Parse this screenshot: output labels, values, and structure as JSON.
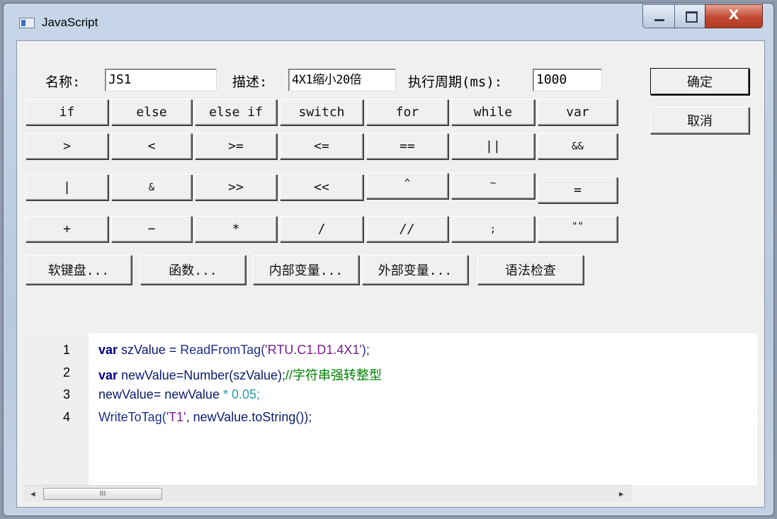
{
  "window": {
    "title": "JavaScript",
    "close_symbol": "X"
  },
  "form": {
    "name_label": "名称:",
    "name_value": "JS1",
    "desc_label": "描述:",
    "desc_value": "4X1缩小20倍",
    "period_label": "执行周期(ms):",
    "period_value": "1000"
  },
  "actions": {
    "ok": "确定",
    "cancel": "取消"
  },
  "keypad": {
    "row1": [
      "if",
      "else",
      "else if",
      "switch",
      "for",
      "while",
      "var"
    ],
    "row2": [
      ">",
      "<",
      ">=",
      "<=",
      "==",
      "||",
      "&&"
    ],
    "row3": [
      "|",
      "&",
      ">>",
      "<<",
      "^",
      "~",
      "="
    ],
    "row4": [
      "+",
      "−",
      "*",
      "/",
      "//",
      ";",
      "\"\""
    ]
  },
  "tools": [
    "软键盘...",
    "函数...",
    "内部变量...",
    "外部变量...",
    "语法检查"
  ],
  "editor": {
    "line_numbers": [
      "1",
      "2",
      "3",
      "4"
    ],
    "code": {
      "l1_kw": "var",
      "l1_id": " szValue = ",
      "l1_fn": "ReadFromTag(",
      "l1_str": "'RTU.C1.D1.4X1'",
      "l1_end": ");",
      "l2_kw": "var",
      "l2_id": " newValue=Number(szValue);",
      "l2_cm": "//字符串强转整型",
      "l3_id": "newValue= newValue ",
      "l3_op": "*",
      "l3_num": " 0.05;",
      "l4_fn": "WriteToTag(",
      "l4_str": "'T1'",
      "l4_id": ", newValue.toString());"
    },
    "scroll_thumb_label": "III",
    "scroll_left": "◀",
    "scroll_right": "▶"
  },
  "icons": [
    "app-icon",
    "minimize-icon",
    "maximize-icon",
    "close-icon"
  ]
}
